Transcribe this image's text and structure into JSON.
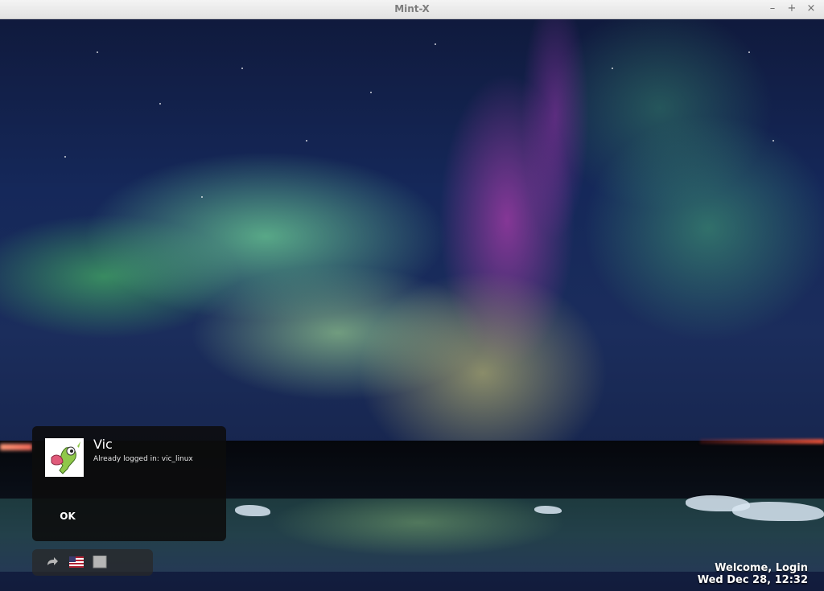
{
  "window": {
    "title": "Mint-X",
    "controls": {
      "minimize": "–",
      "maximize": "+",
      "close": "×"
    }
  },
  "login": {
    "user_name": "Vic",
    "status": "Already logged in: vic_linux",
    "ok_label": "OK"
  },
  "toolbar": {
    "items": [
      {
        "icon": "session-arrow-icon"
      },
      {
        "icon": "us-flag-icon"
      },
      {
        "icon": "gray-square-icon"
      }
    ]
  },
  "footer": {
    "welcome": "Welcome, Login",
    "datetime": "Wed Dec 28, 12:32"
  },
  "colors": {
    "panel_bg": "#0c0c0c",
    "text": "#ffffff",
    "titlebar_text": "#7d7d7d"
  }
}
